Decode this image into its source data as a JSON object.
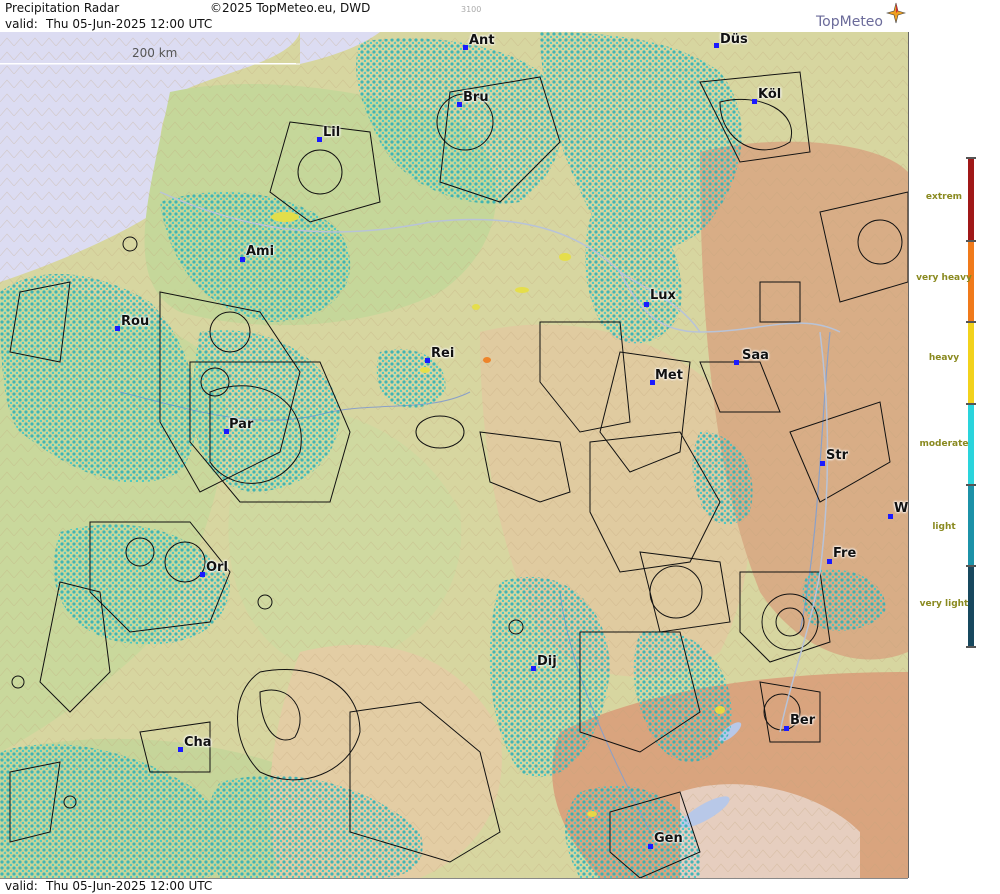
{
  "header": {
    "title": "Precipitation Radar",
    "copyright": "©2025 TopMeteo.eu, DWD",
    "valid_label": "valid:",
    "valid_value": "Thu  05-Jun-2025 12:00 UTC",
    "altitude_hint": "3100",
    "logo": "TopMeteo",
    "logo_icon": "compass-star-icon"
  },
  "footer": {
    "valid_label": "valid:",
    "valid_value": "Thu  05-Jun-2025 12:00 UTC"
  },
  "scale": {
    "label": "200 km"
  },
  "legend": {
    "levels": [
      {
        "label": "extrem",
        "color": "#a01818"
      },
      {
        "label": "very heavy",
        "color": "#f07a1a"
      },
      {
        "label": "heavy",
        "color": "#f2d21c"
      },
      {
        "label": "moderate",
        "color": "#2ad4dc"
      },
      {
        "label": "light",
        "color": "#1c92a8"
      },
      {
        "label": "very light",
        "color": "#17485e"
      }
    ]
  },
  "cities": [
    {
      "abbr": "Ant"
    },
    {
      "abbr": "Düs"
    },
    {
      "abbr": "Bru"
    },
    {
      "abbr": "Köl"
    },
    {
      "abbr": "Lil"
    },
    {
      "abbr": "Ami"
    },
    {
      "abbr": "Rou"
    },
    {
      "abbr": "Rei"
    },
    {
      "abbr": "Lux"
    },
    {
      "abbr": "Saa"
    },
    {
      "abbr": "Met"
    },
    {
      "abbr": "Par"
    },
    {
      "abbr": "Str"
    },
    {
      "abbr": "W"
    },
    {
      "abbr": "Fre"
    },
    {
      "abbr": "Orl"
    },
    {
      "abbr": "Dij"
    },
    {
      "abbr": "Ber"
    },
    {
      "abbr": "Cha"
    },
    {
      "abbr": "Gen"
    }
  ],
  "colors": {
    "sea": "#dcdcf2",
    "lowland": "#c8d9a0",
    "upland": "#e2cfa0",
    "mountain": "#d9a982",
    "radar_light": "#44b8b8",
    "radar_moderate": "#40d8cc",
    "radar_heavy": "#e8e040"
  }
}
